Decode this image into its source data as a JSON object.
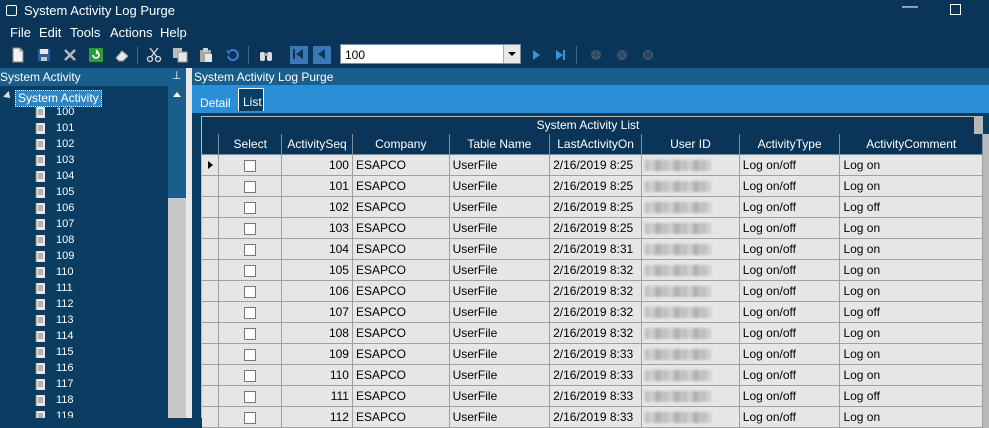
{
  "window": {
    "title": "System Activity Log Purge"
  },
  "menu": [
    "File",
    "Edit",
    "Tools",
    "Actions",
    "Help"
  ],
  "toolbar": {
    "record_value": "100"
  },
  "left_panel": {
    "title": "System Activity",
    "tree_root": "System Activity",
    "items": [
      "100",
      "101",
      "102",
      "103",
      "104",
      "105",
      "106",
      "107",
      "108",
      "109",
      "110",
      "111",
      "112",
      "113",
      "114",
      "115",
      "116",
      "117",
      "118",
      "119"
    ]
  },
  "right_panel": {
    "title": "System Activity Log Purge",
    "tabs": [
      "Detail",
      "List"
    ],
    "active_tab": "List",
    "grid": {
      "caption": "System Activity List",
      "columns": [
        "Select",
        "ActivitySeq",
        "Company",
        "Table Name",
        "LastActivityOn",
        "User ID",
        "ActivityType",
        "ActivityComment"
      ],
      "rows": [
        {
          "seq": "100",
          "company": "ESAPCO",
          "table": "UserFile",
          "on": "2/16/2019 8:25",
          "type": "Log on/off",
          "comment": "Log on"
        },
        {
          "seq": "101",
          "company": "ESAPCO",
          "table": "UserFile",
          "on": "2/16/2019 8:25",
          "type": "Log on/off",
          "comment": "Log on"
        },
        {
          "seq": "102",
          "company": "ESAPCO",
          "table": "UserFile",
          "on": "2/16/2019 8:25",
          "type": "Log on/off",
          "comment": "Log off"
        },
        {
          "seq": "103",
          "company": "ESAPCO",
          "table": "UserFile",
          "on": "2/16/2019 8:25",
          "type": "Log on/off",
          "comment": "Log on"
        },
        {
          "seq": "104",
          "company": "ESAPCO",
          "table": "UserFile",
          "on": "2/16/2019 8:31",
          "type": "Log on/off",
          "comment": "Log on"
        },
        {
          "seq": "105",
          "company": "ESAPCO",
          "table": "UserFile",
          "on": "2/16/2019 8:32",
          "type": "Log on/off",
          "comment": "Log on"
        },
        {
          "seq": "106",
          "company": "ESAPCO",
          "table": "UserFile",
          "on": "2/16/2019 8:32",
          "type": "Log on/off",
          "comment": "Log on"
        },
        {
          "seq": "107",
          "company": "ESAPCO",
          "table": "UserFile",
          "on": "2/16/2019 8:32",
          "type": "Log on/off",
          "comment": "Log off"
        },
        {
          "seq": "108",
          "company": "ESAPCO",
          "table": "UserFile",
          "on": "2/16/2019 8:32",
          "type": "Log on/off",
          "comment": "Log on"
        },
        {
          "seq": "109",
          "company": "ESAPCO",
          "table": "UserFile",
          "on": "2/16/2019 8:33",
          "type": "Log on/off",
          "comment": "Log on"
        },
        {
          "seq": "110",
          "company": "ESAPCO",
          "table": "UserFile",
          "on": "2/16/2019 8:33",
          "type": "Log on/off",
          "comment": "Log on"
        },
        {
          "seq": "111",
          "company": "ESAPCO",
          "table": "UserFile",
          "on": "2/16/2019 8:33",
          "type": "Log on/off",
          "comment": "Log off"
        },
        {
          "seq": "112",
          "company": "ESAPCO",
          "table": "UserFile",
          "on": "2/16/2019 8:33",
          "type": "Log on/off",
          "comment": "Log on"
        }
      ]
    }
  },
  "colors": {
    "background": "#0b3d63",
    "header": "#0a3558",
    "tabbar": "#2a8fd6",
    "selection": "#2f86c4"
  }
}
